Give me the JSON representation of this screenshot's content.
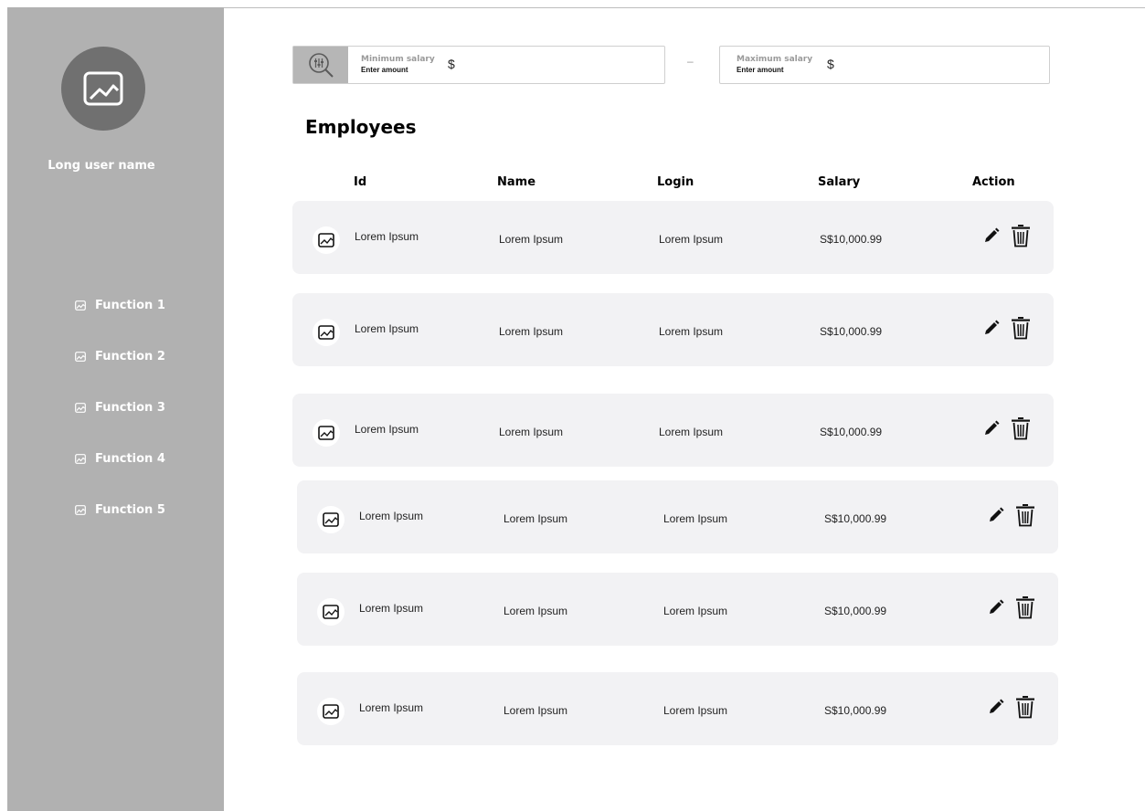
{
  "sidebar": {
    "avatar_icon": "image-placeholder-icon",
    "username": "Long user name",
    "items": [
      {
        "label": "Function 1",
        "icon": "image-icon"
      },
      {
        "label": "Function 2",
        "icon": "image-icon"
      },
      {
        "label": "Function 3",
        "icon": "image-icon"
      },
      {
        "label": "Function 4",
        "icon": "image-icon"
      },
      {
        "label": "Function 5",
        "icon": "image-icon"
      }
    ]
  },
  "filter": {
    "icon": "filter-search-icon",
    "min": {
      "label": "Minimum salary",
      "hint": "Enter amount",
      "currency": "$"
    },
    "separator": "–",
    "max": {
      "label": "Maximum salary",
      "hint": "Enter amount",
      "currency": "$"
    }
  },
  "page_title": "Employees",
  "table": {
    "headers": {
      "id": "Id",
      "name": "Name",
      "login": "Login",
      "salary": "Salary",
      "action": "Action"
    },
    "rows": [
      {
        "id": "Lorem Ipsum",
        "name": "Lorem Ipsum",
        "login": "Lorem Ipsum",
        "salary": "S$10,000.99"
      },
      {
        "id": "Lorem Ipsum",
        "name": "Lorem Ipsum",
        "login": "Lorem Ipsum",
        "salary": "S$10,000.99"
      },
      {
        "id": "Lorem Ipsum",
        "name": "Lorem Ipsum",
        "login": "Lorem Ipsum",
        "salary": "S$10,000.99"
      },
      {
        "id": "Lorem Ipsum",
        "name": "Lorem Ipsum",
        "login": "Lorem Ipsum",
        "salary": "S$10,000.99"
      },
      {
        "id": "Lorem Ipsum",
        "name": "Lorem Ipsum",
        "login": "Lorem Ipsum",
        "salary": "S$10,000.99"
      },
      {
        "id": "Lorem Ipsum",
        "name": "Lorem Ipsum",
        "login": "Lorem Ipsum",
        "salary": "S$10,000.99"
      }
    ],
    "row_actions": [
      "pencil-icon",
      "trash-icon"
    ]
  },
  "colors": {
    "sidebar": "#b1b1b1",
    "avatar": "#707070",
    "row_bg": "#f2f2f4",
    "filter_icon_bg": "#b6b6b6"
  }
}
